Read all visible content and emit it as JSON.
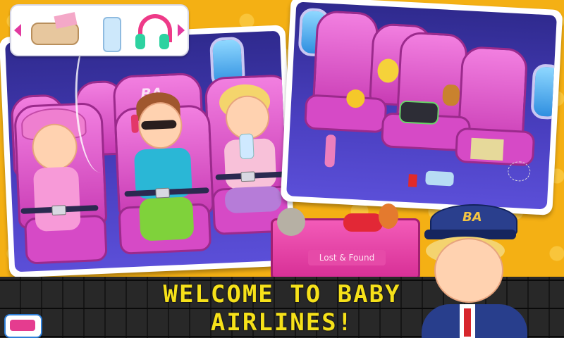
{
  "welcome": {
    "line1": "WELCOME TO BABY",
    "line2": "AIRLINES!"
  },
  "lost_found": {
    "label": "Lost & Found"
  },
  "seat_logo": "BA",
  "pilot_cap_logo": "BA",
  "toolbar": {
    "items": [
      "snack-bag-icon",
      "water-bottle-icon",
      "headphones-icon"
    ]
  },
  "colors": {
    "background": "#f4b014",
    "seat": "#e05cd0",
    "cabin": "#3a33a8",
    "board": "#1c1c1c",
    "board_text": "#f6e11a"
  }
}
